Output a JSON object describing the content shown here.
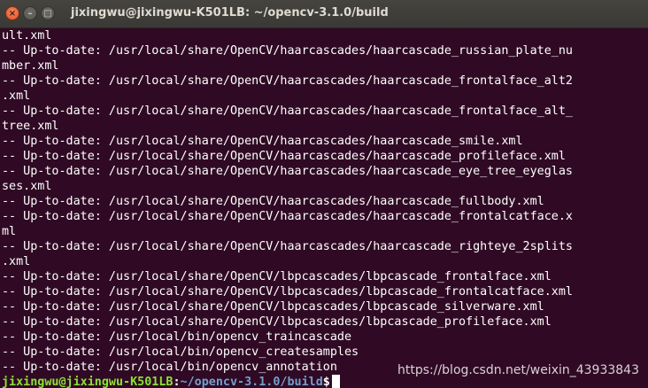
{
  "window": {
    "title": "jixingwu@jixingwu-K501LB: ~/opencv-3.1.0/build",
    "buttons": {
      "close": "×",
      "minimize": "–",
      "maximize": "□"
    }
  },
  "terminal": {
    "lines": [
      "ult.xml",
      "-- Up-to-date: /usr/local/share/OpenCV/haarcascades/haarcascade_russian_plate_nu",
      "mber.xml",
      "-- Up-to-date: /usr/local/share/OpenCV/haarcascades/haarcascade_frontalface_alt2",
      ".xml",
      "-- Up-to-date: /usr/local/share/OpenCV/haarcascades/haarcascade_frontalface_alt_",
      "tree.xml",
      "-- Up-to-date: /usr/local/share/OpenCV/haarcascades/haarcascade_smile.xml",
      "-- Up-to-date: /usr/local/share/OpenCV/haarcascades/haarcascade_profileface.xml",
      "-- Up-to-date: /usr/local/share/OpenCV/haarcascades/haarcascade_eye_tree_eyeglas",
      "ses.xml",
      "-- Up-to-date: /usr/local/share/OpenCV/haarcascades/haarcascade_fullbody.xml",
      "-- Up-to-date: /usr/local/share/OpenCV/haarcascades/haarcascade_frontalcatface.x",
      "ml",
      "-- Up-to-date: /usr/local/share/OpenCV/haarcascades/haarcascade_righteye_2splits",
      ".xml",
      "-- Up-to-date: /usr/local/share/OpenCV/lbpcascades/lbpcascade_frontalface.xml",
      "-- Up-to-date: /usr/local/share/OpenCV/lbpcascades/lbpcascade_frontalcatface.xml",
      "-- Up-to-date: /usr/local/share/OpenCV/lbpcascades/lbpcascade_silverware.xml",
      "-- Up-to-date: /usr/local/share/OpenCV/lbpcascades/lbpcascade_profileface.xml",
      "-- Up-to-date: /usr/local/bin/opencv_traincascade",
      "-- Up-to-date: /usr/local/bin/opencv_createsamples",
      "-- Up-to-date: /usr/local/bin/opencv_annotation"
    ],
    "prompt": {
      "user_host": "jixingwu@jixingwu-K501LB",
      "separator": ":",
      "path": "~/opencv-3.1.0/build",
      "symbol": "$"
    }
  },
  "watermark": "https://blog.csdn.net/weixin_43933843",
  "colors": {
    "background": "#300a24",
    "text": "#ffffff",
    "prompt_user": "#8ae234",
    "prompt_path": "#729fcf",
    "titlebar": "#3f3e3a"
  }
}
